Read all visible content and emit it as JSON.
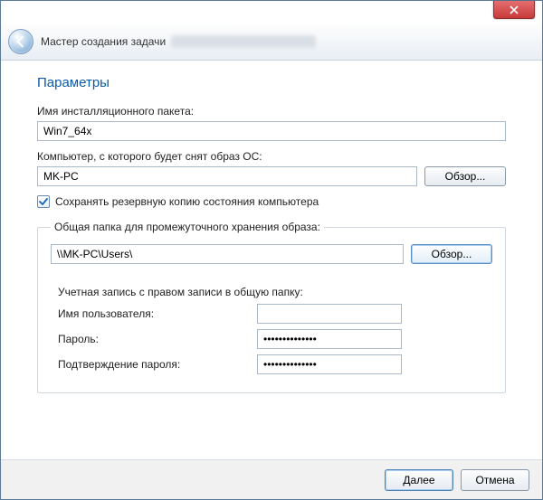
{
  "window": {
    "wizard_title": "Мастер создания задачи"
  },
  "page": {
    "heading": "Параметры",
    "package_label": "Имя инсталляционного пакета:",
    "package_value": "Win7_64x",
    "computer_label": "Компьютер, с которого будет снят образ ОС:",
    "computer_value": "MK-PC",
    "browse": "Обзор...",
    "save_backup_label": "Сохранять резервную копию состояния компьютера",
    "save_backup_checked": true
  },
  "share": {
    "legend": "Общая папка для промежуточного хранения образа:",
    "path_value": "\\\\MK-PC\\Users\\",
    "browse": "Обзор...",
    "cred_label": "Учетная запись с правом записи в общую папку:",
    "user_label": "Имя пользователя:",
    "user_value": "",
    "pass_label": "Пароль:",
    "pass_value": "••••••••••••••",
    "conf_label": "Подтверждение пароля:",
    "conf_value": "••••••••••••••"
  },
  "footer": {
    "next": "Далее",
    "cancel": "Отмена"
  }
}
